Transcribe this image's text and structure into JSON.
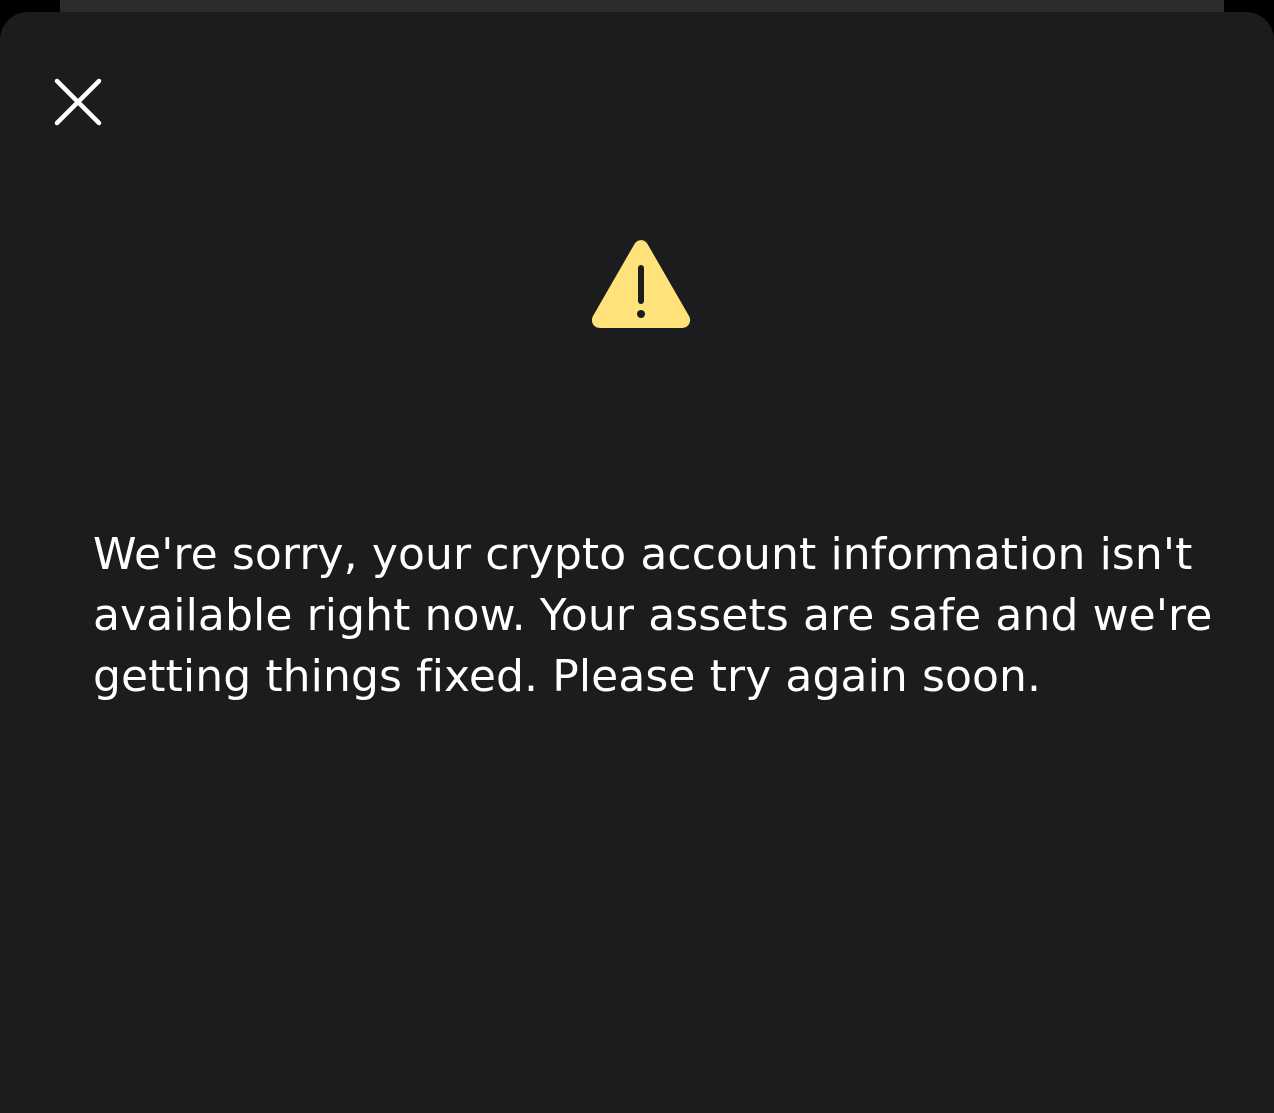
{
  "dialog": {
    "close_icon": "close-icon",
    "warning_icon": "warning-triangle-icon",
    "accent_color": "#FFE27A",
    "background_color": "#1C1C1E",
    "message": "We're sorry, your crypto account information isn't available right now. Your assets are safe and we're getting things fixed. Please try again soon."
  }
}
